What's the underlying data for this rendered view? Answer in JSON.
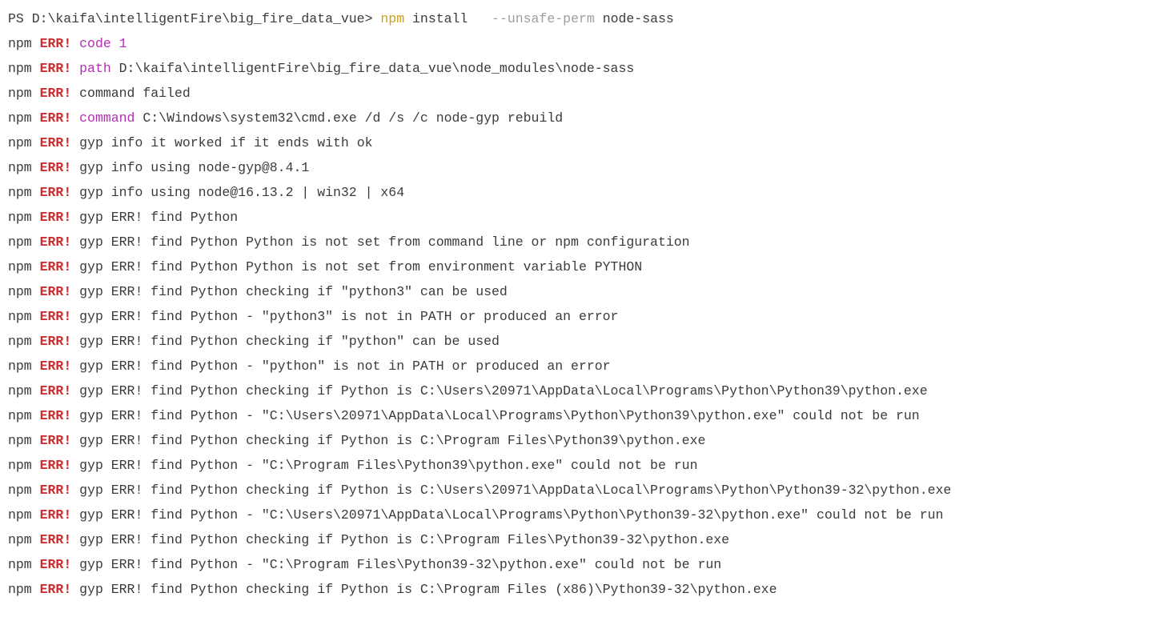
{
  "prompt": {
    "ps": "PS D:\\kaifa\\intelligentFire\\big_fire_data_vue>",
    "npm": "npm",
    "install": "install",
    "flag": "--unsafe-perm",
    "pkg": "node-sass"
  },
  "lines": [
    {
      "prefix": "npm",
      "err": "ERR!",
      "kw": "code",
      "kwClass": "code-kw",
      "rest": "1",
      "restClass": "code-val"
    },
    {
      "prefix": "npm",
      "err": "ERR!",
      "kw": "path",
      "kwClass": "path-kw",
      "rest": "D:\\kaifa\\intelligentFire\\big_fire_data_vue\\node_modules\\node-sass",
      "restClass": "plain"
    },
    {
      "prefix": "npm",
      "err": "ERR!",
      "kw": "",
      "kwClass": "",
      "rest": "command failed",
      "restClass": "plain"
    },
    {
      "prefix": "npm",
      "err": "ERR!",
      "kw": "command",
      "kwClass": "cmd-kw",
      "rest": "C:\\Windows\\system32\\cmd.exe /d /s /c node-gyp rebuild",
      "restClass": "plain"
    },
    {
      "prefix": "npm",
      "err": "ERR!",
      "kw": "",
      "kwClass": "",
      "rest": "gyp info it worked if it ends with ok",
      "restClass": "plain"
    },
    {
      "prefix": "npm",
      "err": "ERR!",
      "kw": "",
      "kwClass": "",
      "rest": "gyp info using node-gyp@8.4.1",
      "restClass": "plain"
    },
    {
      "prefix": "npm",
      "err": "ERR!",
      "kw": "",
      "kwClass": "",
      "rest": "gyp info using node@16.13.2 | win32 | x64",
      "restClass": "plain"
    },
    {
      "prefix": "npm",
      "err": "ERR!",
      "kw": "",
      "kwClass": "",
      "rest": "gyp ERR! find Python",
      "restClass": "plain"
    },
    {
      "prefix": "npm",
      "err": "ERR!",
      "kw": "",
      "kwClass": "",
      "rest": "gyp ERR! find Python Python is not set from command line or npm configuration",
      "restClass": "plain"
    },
    {
      "prefix": "npm",
      "err": "ERR!",
      "kw": "",
      "kwClass": "",
      "rest": "gyp ERR! find Python Python is not set from environment variable PYTHON",
      "restClass": "plain"
    },
    {
      "prefix": "npm",
      "err": "ERR!",
      "kw": "",
      "kwClass": "",
      "rest": "gyp ERR! find Python checking if \"python3\" can be used",
      "restClass": "plain"
    },
    {
      "prefix": "npm",
      "err": "ERR!",
      "kw": "",
      "kwClass": "",
      "rest": "gyp ERR! find Python - \"python3\" is not in PATH or produced an error",
      "restClass": "plain"
    },
    {
      "prefix": "npm",
      "err": "ERR!",
      "kw": "",
      "kwClass": "",
      "rest": "gyp ERR! find Python checking if \"python\" can be used",
      "restClass": "plain"
    },
    {
      "prefix": "npm",
      "err": "ERR!",
      "kw": "",
      "kwClass": "",
      "rest": "gyp ERR! find Python - \"python\" is not in PATH or produced an error",
      "restClass": "plain"
    },
    {
      "prefix": "npm",
      "err": "ERR!",
      "kw": "",
      "kwClass": "",
      "rest": "gyp ERR! find Python checking if Python is C:\\Users\\20971\\AppData\\Local\\Programs\\Python\\Python39\\python.exe",
      "restClass": "plain"
    },
    {
      "prefix": "npm",
      "err": "ERR!",
      "kw": "",
      "kwClass": "",
      "rest": "gyp ERR! find Python - \"C:\\Users\\20971\\AppData\\Local\\Programs\\Python\\Python39\\python.exe\" could not be run",
      "restClass": "plain"
    },
    {
      "prefix": "npm",
      "err": "ERR!",
      "kw": "",
      "kwClass": "",
      "rest": "gyp ERR! find Python checking if Python is C:\\Program Files\\Python39\\python.exe",
      "restClass": "plain"
    },
    {
      "prefix": "npm",
      "err": "ERR!",
      "kw": "",
      "kwClass": "",
      "rest": "gyp ERR! find Python - \"C:\\Program Files\\Python39\\python.exe\" could not be run",
      "restClass": "plain"
    },
    {
      "prefix": "npm",
      "err": "ERR!",
      "kw": "",
      "kwClass": "",
      "rest": "gyp ERR! find Python checking if Python is C:\\Users\\20971\\AppData\\Local\\Programs\\Python\\Python39-32\\python.exe",
      "restClass": "plain"
    },
    {
      "prefix": "npm",
      "err": "ERR!",
      "kw": "",
      "kwClass": "",
      "rest": "gyp ERR! find Python - \"C:\\Users\\20971\\AppData\\Local\\Programs\\Python\\Python39-32\\python.exe\" could not be run",
      "restClass": "plain"
    },
    {
      "prefix": "npm",
      "err": "ERR!",
      "kw": "",
      "kwClass": "",
      "rest": "gyp ERR! find Python checking if Python is C:\\Program Files\\Python39-32\\python.exe",
      "restClass": "plain"
    },
    {
      "prefix": "npm",
      "err": "ERR!",
      "kw": "",
      "kwClass": "",
      "rest": "gyp ERR! find Python - \"C:\\Program Files\\Python39-32\\python.exe\" could not be run",
      "restClass": "plain"
    },
    {
      "prefix": "npm",
      "err": "ERR!",
      "kw": "",
      "kwClass": "",
      "rest": "gyp ERR! find Python checking if Python is C:\\Program Files (x86)\\Python39-32\\python.exe",
      "restClass": "plain"
    }
  ]
}
